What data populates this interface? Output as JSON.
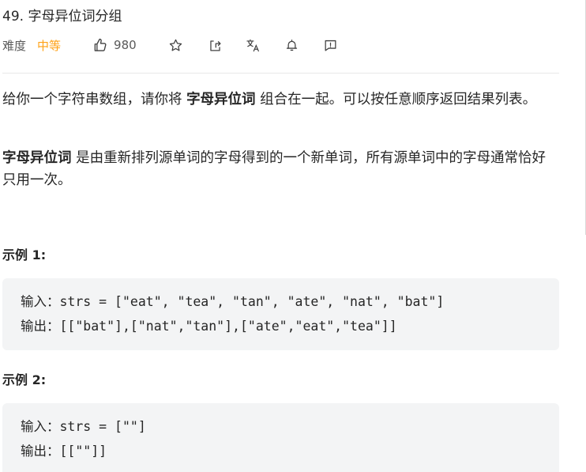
{
  "problem": {
    "title": "49. 字母异位词分组",
    "difficulty_label": "难度",
    "difficulty_value": "中等",
    "likes": "980"
  },
  "toolbar_icons": [
    "thumbs-up-icon",
    "star-icon",
    "share-icon",
    "translate-icon",
    "bell-icon",
    "feedback-icon"
  ],
  "colors": {
    "difficulty_medium": "#ffa116",
    "code_bg": "#f3f4f5",
    "divider": "#e8e8e8"
  },
  "description": {
    "p1_before": "给你一个字符串数组，请你将 ",
    "p1_bold": "字母异位词",
    "p1_after": " 组合在一起。可以按任意顺序返回结果列表。",
    "p2_bold": "字母异位词",
    "p2_after": " 是由重新排列源单词的字母得到的一个新单词，所有源单词中的字母通常恰好只用一次。"
  },
  "examples": [
    {
      "title": "示例 1:",
      "input": "输入：strs = [\"eat\", \"tea\", \"tan\", \"ate\", \"nat\", \"bat\"]",
      "output": "输出：[[\"bat\"],[\"nat\",\"tan\"],[\"ate\",\"eat\",\"tea\"]]"
    },
    {
      "title": "示例 2:",
      "input": "输入：strs = [\"\"]",
      "output": "输出：[[\"\"]]"
    }
  ]
}
